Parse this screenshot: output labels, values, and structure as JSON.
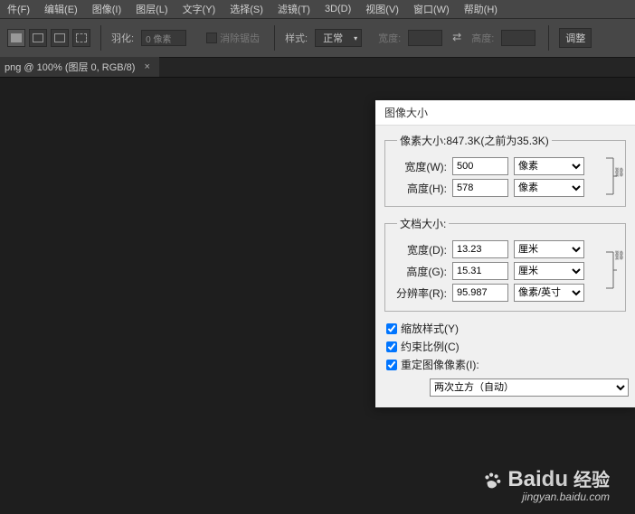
{
  "menu": {
    "items": [
      "件(F)",
      "编辑(E)",
      "图像(I)",
      "图层(L)",
      "文字(Y)",
      "选择(S)",
      "滤镜(T)",
      "3D(D)",
      "视图(V)",
      "窗口(W)",
      "帮助(H)"
    ]
  },
  "options": {
    "feather_label": "羽化:",
    "feather_value": "0 像素",
    "antialias_label": "消除锯齿",
    "style_label": "样式:",
    "style_value": "正常",
    "width_label": "宽度:",
    "height_label": "高度:",
    "adjust_label": "调整"
  },
  "tab": {
    "label": "png @ 100% (图层 0, RGB/8)",
    "close": "×"
  },
  "dialog": {
    "title": "图像大小",
    "pixel_dims": {
      "legend": "像素大小:847.3K(之前为35.3K)",
      "width_label": "宽度(W):",
      "width_value": "500",
      "width_unit": "像素",
      "height_label": "高度(H):",
      "height_value": "578",
      "height_unit": "像素"
    },
    "doc_dims": {
      "legend": "文档大小:",
      "width_label": "宽度(D):",
      "width_value": "13.23",
      "width_unit": "厘米",
      "height_label": "高度(G):",
      "height_value": "15.31",
      "height_unit": "厘米",
      "res_label": "分辨率(R):",
      "res_value": "95.987",
      "res_unit": "像素/英寸"
    },
    "scale_styles": "缩放样式(Y)",
    "constrain": "约束比例(C)",
    "resample": "重定图像像素(I):",
    "resample_method": "两次立方（自动）"
  },
  "watermark": {
    "brand_a": "Bai",
    "brand_b": "du",
    "brand_c": "经验",
    "url": "jingyan.baidu.com"
  }
}
